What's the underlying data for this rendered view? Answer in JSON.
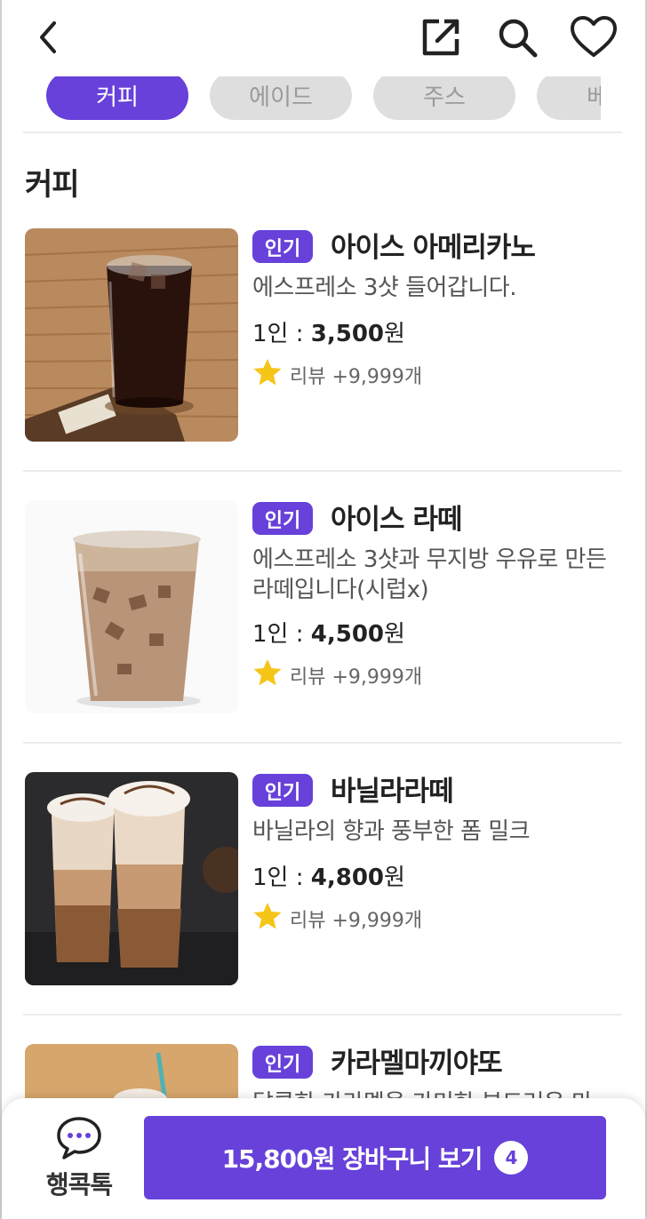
{
  "header": {
    "back_icon": "chevron-left-icon",
    "share_icon": "external-link-icon",
    "search_icon": "search-icon",
    "favorite_icon": "heart-icon"
  },
  "tabs": [
    {
      "label": "커피",
      "active": true
    },
    {
      "label": "에이드",
      "active": false
    },
    {
      "label": "주스",
      "active": false
    },
    {
      "label": "베이",
      "active": false
    }
  ],
  "section": {
    "title": "커피"
  },
  "items": [
    {
      "badge": "인기",
      "name": "아이스 아메리카노",
      "description": "에스프레소 3샷 들어갑니다.",
      "price_prefix": "1인 : ",
      "price": "3,500",
      "price_unit": "원",
      "review": "리뷰 +9,999개"
    },
    {
      "badge": "인기",
      "name": "아이스 라떼",
      "description": "에스프레소 3샷과 무지방 우유로 만든 라떼입니다(시럽x)",
      "price_prefix": "1인 : ",
      "price": "4,500",
      "price_unit": "원",
      "review": "리뷰 +9,999개"
    },
    {
      "badge": "인기",
      "name": "바닐라라떼",
      "description": "바닐라의 향과 풍부한 폼 밀크",
      "price_prefix": "1인 : ",
      "price": "4,800",
      "price_unit": "원",
      "review": "리뷰 +9,999개"
    },
    {
      "badge": "인기",
      "name": "카라멜마끼야또",
      "description": "달콤한 카라멜을 가미한 부드러운 마",
      "price_prefix": "",
      "price": "",
      "price_unit": "",
      "review": ""
    }
  ],
  "bottom": {
    "talk_label": "행콕톡",
    "talk_icon": "chat-bubble-icon",
    "cart_label": "15,800원 장바구니 보기",
    "cart_count": "4"
  },
  "colors": {
    "accent": "#6741d9",
    "tab_inactive": "#dedede",
    "star": "#f5c518"
  }
}
